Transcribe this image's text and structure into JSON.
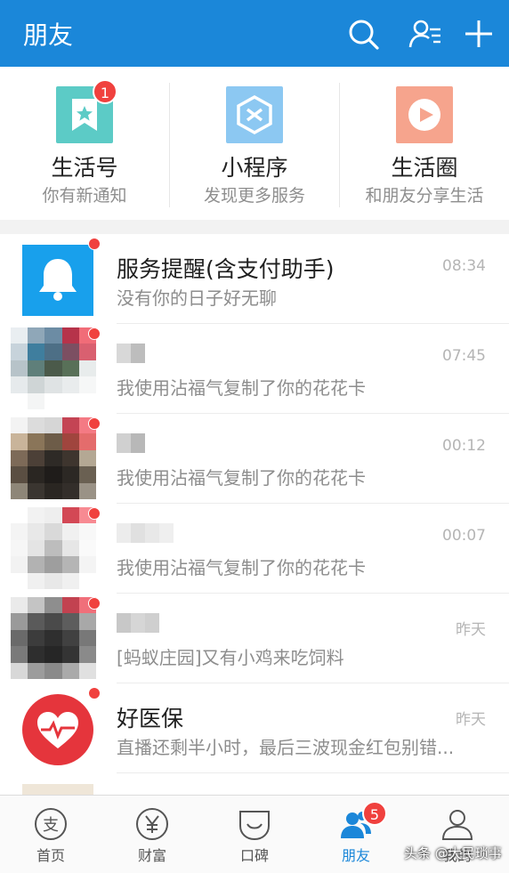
{
  "header": {
    "title": "朋友",
    "icons": [
      "search-icon",
      "contacts-icon",
      "add-icon"
    ],
    "color": "#1b87d9"
  },
  "quick_cards": [
    {
      "title": "生活号",
      "subtitle": "你有新通知",
      "badge": "1",
      "icon": "bookmark-star-icon",
      "color": "#5ccbc6"
    },
    {
      "title": "小程序",
      "subtitle": "发现更多服务",
      "icon": "miniprogram-icon",
      "color": "#8cc8f2"
    },
    {
      "title": "生活圈",
      "subtitle": "和朋友分享生活",
      "icon": "life-circle-icon",
      "color": "#f6a48d"
    }
  ],
  "conversations": [
    {
      "name": "服务提醒(含支付助手)",
      "message": "没有你的日子好无聊",
      "time": "08:34",
      "unread": true,
      "icon": "bell-icon"
    },
    {
      "name": "",
      "message": "我使用沾福气复制了你的花花卡",
      "time": "07:45",
      "unread": true,
      "icon": "blurred-avatar"
    },
    {
      "name": "",
      "message": "我使用沾福气复制了你的花花卡",
      "time": "00:12",
      "unread": true,
      "icon": "blurred-avatar"
    },
    {
      "name": "",
      "message": "我使用沾福气复制了你的花花卡",
      "time": "00:07",
      "unread": true,
      "icon": "blurred-avatar"
    },
    {
      "name": "",
      "message": "[蚂蚁庄园]又有小鸡来吃饲料",
      "time": "昨天",
      "unread": true,
      "icon": "blurred-avatar"
    },
    {
      "name": "好医保",
      "message": "直播还剩半小时，最后三波现金红包别错...",
      "time": "昨天",
      "unread": true,
      "icon": "heart-pulse-icon"
    }
  ],
  "tabs": [
    {
      "label": "首页",
      "icon": "alipay-home-icon",
      "active": false
    },
    {
      "label": "财富",
      "icon": "yen-icon",
      "active": false
    },
    {
      "label": "口碑",
      "icon": "koubei-icon",
      "active": false
    },
    {
      "label": "朋友",
      "icon": "friends-icon",
      "active": true,
      "badge": "5"
    },
    {
      "label": "我的",
      "icon": "person-icon",
      "active": false
    }
  ],
  "watermark": "头条 @大民琐事"
}
